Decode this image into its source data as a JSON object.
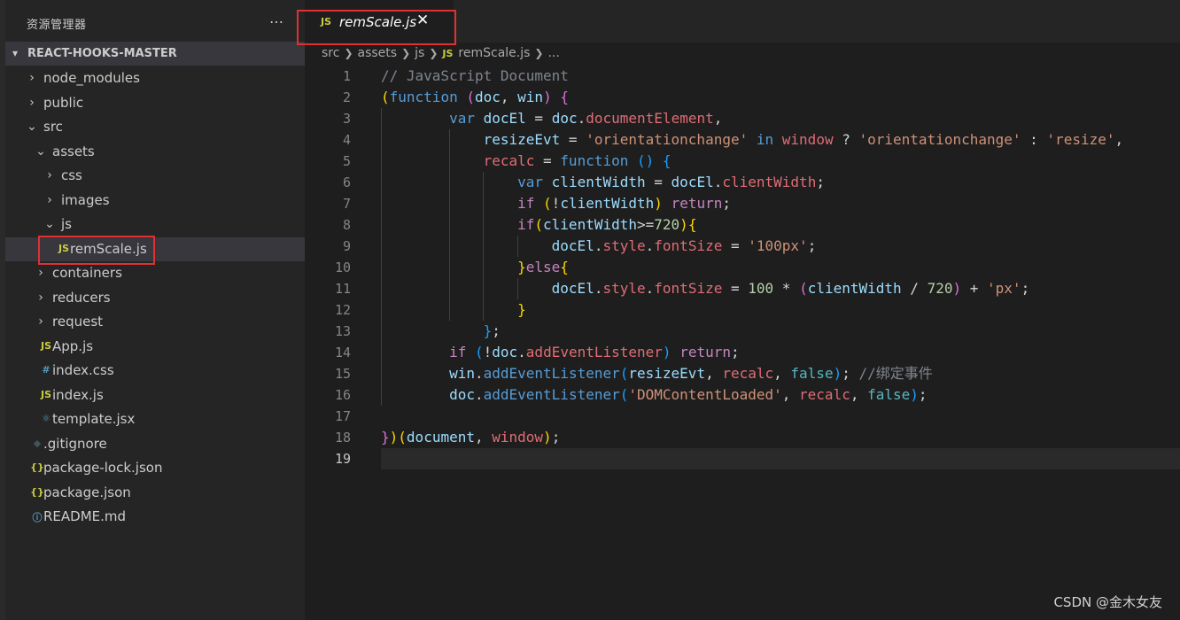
{
  "sidebar": {
    "title": "资源管理器",
    "more_icon": "…",
    "root": "REACT-HOOKS-MASTER",
    "items": [
      {
        "label": "node_modules",
        "type": "folder",
        "expanded": false,
        "depth": 1
      },
      {
        "label": "public",
        "type": "folder",
        "expanded": false,
        "depth": 1
      },
      {
        "label": "src",
        "type": "folder",
        "expanded": true,
        "depth": 1
      },
      {
        "label": "assets",
        "type": "folder",
        "expanded": true,
        "depth": 2
      },
      {
        "label": "css",
        "type": "folder",
        "expanded": false,
        "depth": 3
      },
      {
        "label": "images",
        "type": "folder",
        "expanded": false,
        "depth": 3
      },
      {
        "label": "js",
        "type": "folder",
        "expanded": true,
        "depth": 3
      },
      {
        "label": "remScale.js",
        "type": "js",
        "depth": 4,
        "selected": true
      },
      {
        "label": "containers",
        "type": "folder",
        "expanded": false,
        "depth": 2
      },
      {
        "label": "reducers",
        "type": "folder",
        "expanded": false,
        "depth": 2
      },
      {
        "label": "request",
        "type": "folder",
        "expanded": false,
        "depth": 2
      },
      {
        "label": "App.js",
        "type": "js",
        "depth": 2
      },
      {
        "label": "index.css",
        "type": "css",
        "depth": 2
      },
      {
        "label": "index.js",
        "type": "js",
        "depth": 2
      },
      {
        "label": "template.jsx",
        "type": "jsx",
        "depth": 2
      },
      {
        "label": ".gitignore",
        "type": "git",
        "depth": 1
      },
      {
        "label": "package-lock.json",
        "type": "json",
        "depth": 1
      },
      {
        "label": "package.json",
        "type": "json",
        "depth": 1
      },
      {
        "label": "README.md",
        "type": "info",
        "depth": 1
      }
    ]
  },
  "tab": {
    "icon": "JS",
    "label": "remScale.js",
    "close_icon": "✕"
  },
  "breadcrumb": {
    "parts": [
      "src",
      "assets",
      "js",
      "remScale.js",
      "..."
    ],
    "js_icon": "JS"
  },
  "colors": {
    "keyword": "#c586c0",
    "func_kw": "#569cd6",
    "variable": "#9cdcfe",
    "property": "#e06c75",
    "string": "#ce9178",
    "number": "#b5cea8",
    "comment": "#7f848e",
    "bool": "#56b6c2",
    "paren1": "#ffd700",
    "paren2": "#da70d6",
    "paren3": "#179fff",
    "punct": "#d4d4d4",
    "red_highlight": "#e03030",
    "js_icon": "#cbcb41"
  },
  "code_lines": [
    {
      "n": "1",
      "tokens": [
        [
          "// JavaScript Document",
          "comment"
        ]
      ]
    },
    {
      "n": "2",
      "tokens": [
        [
          "(",
          "paren1"
        ],
        [
          "function",
          "func_kw"
        ],
        [
          " ",
          "punct"
        ],
        [
          "(",
          "paren2"
        ],
        [
          "doc",
          "variable"
        ],
        [
          ", ",
          "punct"
        ],
        [
          "win",
          "variable"
        ],
        [
          ")",
          "paren2"
        ],
        [
          " ",
          "punct"
        ],
        [
          "{",
          "paren2"
        ]
      ]
    },
    {
      "n": "3",
      "tokens": [
        [
          "        ",
          "punct"
        ],
        [
          "var",
          "func_kw"
        ],
        [
          " ",
          "punct"
        ],
        [
          "docEl",
          "variable"
        ],
        [
          " = ",
          "punct"
        ],
        [
          "doc",
          "variable"
        ],
        [
          ".",
          "punct"
        ],
        [
          "documentElement",
          "property"
        ],
        [
          ",",
          "punct"
        ]
      ]
    },
    {
      "n": "4",
      "tokens": [
        [
          "            ",
          "punct"
        ],
        [
          "resizeEvt",
          "variable"
        ],
        [
          " = ",
          "punct"
        ],
        [
          "'orientationchange'",
          "string"
        ],
        [
          " ",
          "punct"
        ],
        [
          "in",
          "func_kw"
        ],
        [
          " ",
          "punct"
        ],
        [
          "window",
          "property"
        ],
        [
          " ? ",
          "punct"
        ],
        [
          "'orientationchange'",
          "string"
        ],
        [
          " : ",
          "punct"
        ],
        [
          "'resize'",
          "string"
        ],
        [
          ",",
          "punct"
        ]
      ]
    },
    {
      "n": "5",
      "tokens": [
        [
          "            ",
          "punct"
        ],
        [
          "recalc",
          "property"
        ],
        [
          " = ",
          "punct"
        ],
        [
          "function",
          "func_kw"
        ],
        [
          " ",
          "punct"
        ],
        [
          "()",
          "paren3"
        ],
        [
          " ",
          "punct"
        ],
        [
          "{",
          "paren3"
        ]
      ]
    },
    {
      "n": "6",
      "tokens": [
        [
          "                ",
          "punct"
        ],
        [
          "var",
          "func_kw"
        ],
        [
          " ",
          "punct"
        ],
        [
          "clientWidth",
          "variable"
        ],
        [
          " = ",
          "punct"
        ],
        [
          "docEl",
          "variable"
        ],
        [
          ".",
          "punct"
        ],
        [
          "clientWidth",
          "property"
        ],
        [
          ";",
          "punct"
        ]
      ]
    },
    {
      "n": "7",
      "tokens": [
        [
          "                ",
          "punct"
        ],
        [
          "if",
          "keyword"
        ],
        [
          " ",
          "punct"
        ],
        [
          "(",
          "paren1"
        ],
        [
          "!",
          "punct"
        ],
        [
          "clientWidth",
          "variable"
        ],
        [
          ")",
          "paren1"
        ],
        [
          " ",
          "punct"
        ],
        [
          "return",
          "keyword"
        ],
        [
          ";",
          "punct"
        ]
      ]
    },
    {
      "n": "8",
      "tokens": [
        [
          "                ",
          "punct"
        ],
        [
          "if",
          "keyword"
        ],
        [
          "(",
          "paren1"
        ],
        [
          "clientWidth",
          "variable"
        ],
        [
          ">=",
          "punct"
        ],
        [
          "720",
          "number"
        ],
        [
          ")",
          "paren1"
        ],
        [
          "{",
          "paren1"
        ]
      ]
    },
    {
      "n": "9",
      "tokens": [
        [
          "                    ",
          "punct"
        ],
        [
          "docEl",
          "variable"
        ],
        [
          ".",
          "punct"
        ],
        [
          "style",
          "property"
        ],
        [
          ".",
          "punct"
        ],
        [
          "fontSize",
          "property"
        ],
        [
          " = ",
          "punct"
        ],
        [
          "'100px'",
          "string"
        ],
        [
          ";",
          "punct"
        ]
      ]
    },
    {
      "n": "10",
      "tokens": [
        [
          "                ",
          "punct"
        ],
        [
          "}",
          "paren1"
        ],
        [
          "else",
          "keyword"
        ],
        [
          "{",
          "paren1"
        ]
      ]
    },
    {
      "n": "11",
      "tokens": [
        [
          "                    ",
          "punct"
        ],
        [
          "docEl",
          "variable"
        ],
        [
          ".",
          "punct"
        ],
        [
          "style",
          "property"
        ],
        [
          ".",
          "punct"
        ],
        [
          "fontSize",
          "property"
        ],
        [
          " = ",
          "punct"
        ],
        [
          "100",
          "number"
        ],
        [
          " * ",
          "punct"
        ],
        [
          "(",
          "paren2"
        ],
        [
          "clientWidth",
          "variable"
        ],
        [
          " / ",
          "punct"
        ],
        [
          "720",
          "number"
        ],
        [
          ")",
          "paren2"
        ],
        [
          " + ",
          "punct"
        ],
        [
          "'px'",
          "string"
        ],
        [
          ";",
          "punct"
        ]
      ]
    },
    {
      "n": "12",
      "tokens": [
        [
          "                ",
          "punct"
        ],
        [
          "}",
          "paren1"
        ]
      ]
    },
    {
      "n": "13",
      "tokens": [
        [
          "            ",
          "punct"
        ],
        [
          "}",
          "paren3"
        ],
        [
          ";",
          "punct"
        ]
      ]
    },
    {
      "n": "14",
      "tokens": [
        [
          "        ",
          "punct"
        ],
        [
          "if",
          "keyword"
        ],
        [
          " ",
          "punct"
        ],
        [
          "(",
          "paren3"
        ],
        [
          "!",
          "punct"
        ],
        [
          "doc",
          "variable"
        ],
        [
          ".",
          "punct"
        ],
        [
          "addEventListener",
          "property"
        ],
        [
          ")",
          "paren3"
        ],
        [
          " ",
          "punct"
        ],
        [
          "return",
          "keyword"
        ],
        [
          ";",
          "punct"
        ]
      ]
    },
    {
      "n": "15",
      "tokens": [
        [
          "        ",
          "punct"
        ],
        [
          "win",
          "variable"
        ],
        [
          ".",
          "punct"
        ],
        [
          "addEventListener",
          "func_kw"
        ],
        [
          "(",
          "paren3"
        ],
        [
          "resizeEvt",
          "variable"
        ],
        [
          ", ",
          "punct"
        ],
        [
          "recalc",
          "property"
        ],
        [
          ", ",
          "punct"
        ],
        [
          "false",
          "bool"
        ],
        [
          ")",
          "paren3"
        ],
        [
          "; ",
          "punct"
        ],
        [
          "//绑定事件",
          "comment"
        ]
      ]
    },
    {
      "n": "16",
      "tokens": [
        [
          "        ",
          "punct"
        ],
        [
          "doc",
          "variable"
        ],
        [
          ".",
          "punct"
        ],
        [
          "addEventListener",
          "func_kw"
        ],
        [
          "(",
          "paren3"
        ],
        [
          "'DOMContentLoaded'",
          "string"
        ],
        [
          ", ",
          "punct"
        ],
        [
          "recalc",
          "property"
        ],
        [
          ", ",
          "punct"
        ],
        [
          "false",
          "bool"
        ],
        [
          ")",
          "paren3"
        ],
        [
          ";",
          "punct"
        ]
      ]
    },
    {
      "n": "17",
      "tokens": []
    },
    {
      "n": "18",
      "tokens": [
        [
          "}",
          "paren2"
        ],
        [
          ")",
          "paren1"
        ],
        [
          "(",
          "paren1"
        ],
        [
          "document",
          "variable"
        ],
        [
          ", ",
          "punct"
        ],
        [
          "window",
          "property"
        ],
        [
          ")",
          "paren1"
        ],
        [
          ";",
          "punct"
        ]
      ]
    },
    {
      "n": "19",
      "tokens": []
    }
  ],
  "current_line": "19",
  "watermark": "CSDN @金木女友"
}
